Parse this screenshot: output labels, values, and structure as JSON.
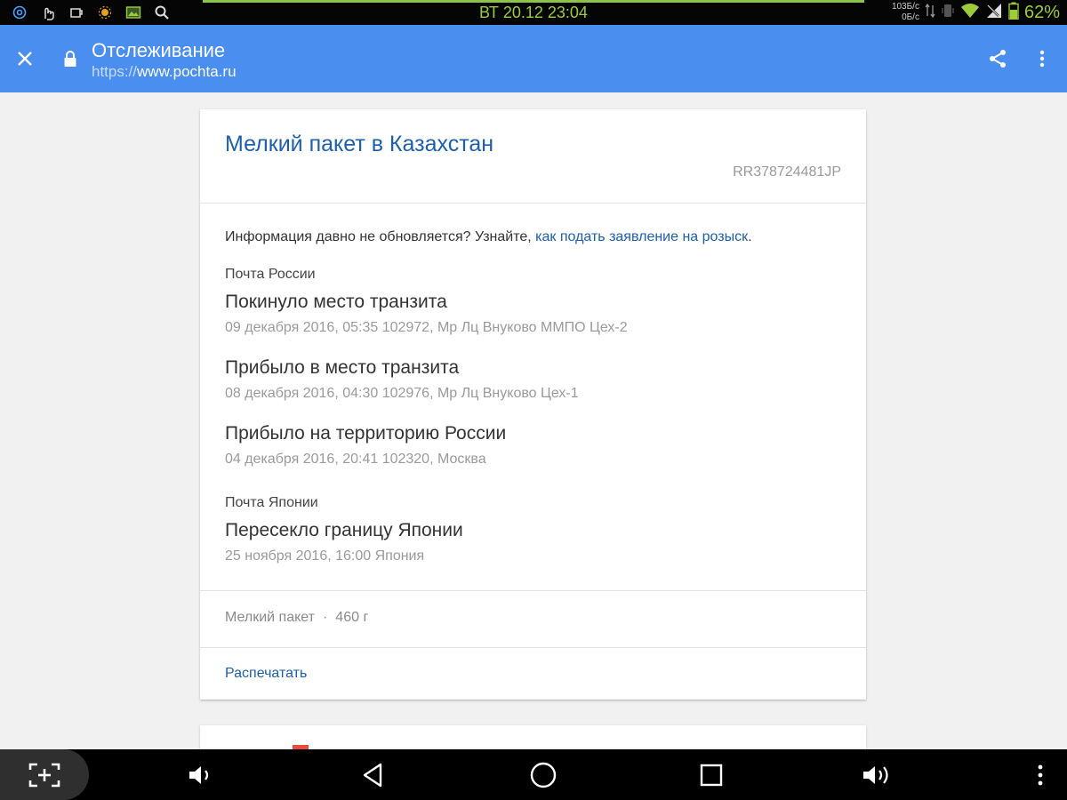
{
  "status_bar": {
    "clock": "ВТ 20.12 23:04",
    "net_up": "103Б/с",
    "net_down": "0Б/с",
    "battery": "62%",
    "accent_color": "#9ccc3c"
  },
  "toolbar": {
    "title": "Отслеживание",
    "url_scheme": "https://",
    "url_host": "www.pochta.ru",
    "background": "#4a8ef0"
  },
  "card": {
    "package_title": "Мелкий пакет в Казахстан",
    "tracking_number": "RR378724481JP",
    "notice_text": "Информация давно не обновляется? Узнайте, ",
    "notice_link": "как подать заявление на розыск",
    "notice_end": ".",
    "groups": [
      {
        "carrier": "Почта России",
        "events": [
          {
            "title": "Покинуло место транзита",
            "meta": "09 декабря 2016, 05:35 102972, Мр Лц Внуково ММПО Цех-2"
          },
          {
            "title": "Прибыло в место транзита",
            "meta": "08 декабря 2016, 04:30 102976, Мр Лц Внуково Цех-1"
          },
          {
            "title": "Прибыло на территорию России",
            "meta": "04 декабря 2016, 20:41 102320, Москва"
          }
        ]
      },
      {
        "carrier": "Почта Японии",
        "events": [
          {
            "title": "Пересекло границу Японии",
            "meta": "25 ноября 2016, 16:00 Япония"
          }
        ]
      }
    ],
    "summary_type": "Мелкий пакет",
    "summary_sep": "·",
    "summary_weight": "460 г",
    "print_label": "Распечатать",
    "link_color": "#1f5fa8"
  }
}
